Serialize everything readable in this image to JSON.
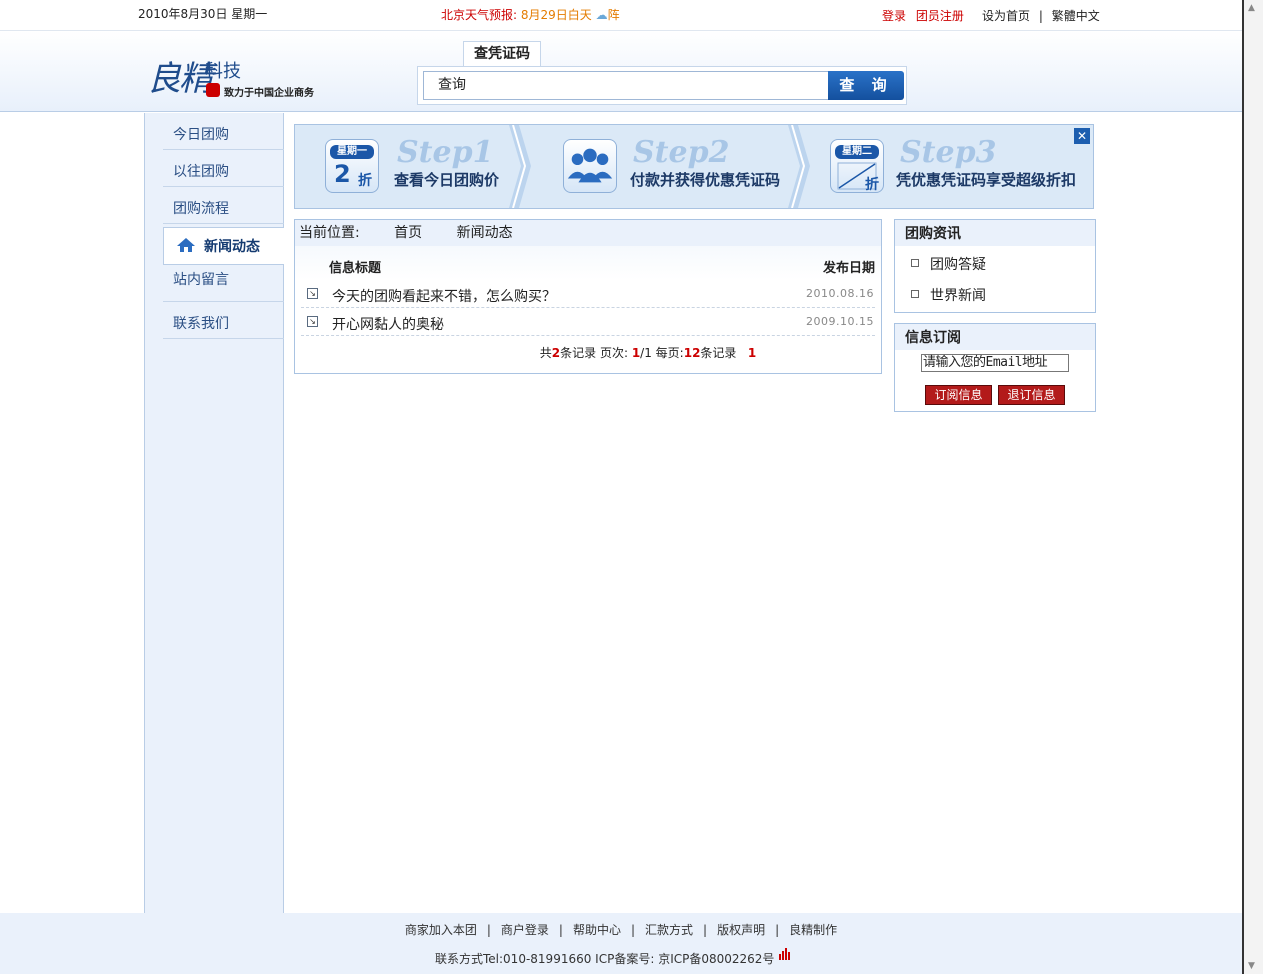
{
  "topbar": {
    "date": "2010年8月30日  星期一",
    "weather_label": "北京天气预报:",
    "weather_value": "8月29日白天",
    "weather_icon": "rain-cloud-icon",
    "weather_text": "阵",
    "login": "登录",
    "register": "团员注册",
    "homepage": "设为首页",
    "sep": "|",
    "traditional": "繁體中文"
  },
  "logo": {
    "main": "良精",
    "sub1": "科技",
    "sub2": "致力于中国企业商务"
  },
  "search": {
    "tab": "查凭证码",
    "value": "查询",
    "button": "查 询"
  },
  "sidebar": {
    "items": [
      {
        "label": "今日团购"
      },
      {
        "label": "以往团购"
      },
      {
        "label": "团购流程"
      },
      {
        "label": "新闻动态"
      },
      {
        "label": "站内留言"
      },
      {
        "label": "联系我们"
      }
    ]
  },
  "steps": [
    {
      "day": "星期一",
      "big": "2",
      "small": "折",
      "title": "Step1",
      "desc": "查看今日团购价"
    },
    {
      "title": "Step2",
      "desc": "付款并获得优惠凭证码"
    },
    {
      "day": "星期二",
      "small": "折",
      "title": "Step3",
      "desc": "凭优惠凭证码享受超级折扣"
    }
  ],
  "news": {
    "crumb_label": "当前位置:",
    "crumb_home": "首页",
    "crumb_current": "新闻动态",
    "col_title": "信息标题",
    "col_date": "发布日期",
    "rows": [
      {
        "title": "今天的团购看起来不错，怎么购买？",
        "date": "2010.08.16"
      },
      {
        "title": "开心网黏人的奥秘",
        "date": "2009.10.15"
      }
    ],
    "pager": {
      "p1": "共",
      "total": "2",
      "p2": "条记录 页次:",
      "cur": "1",
      "p3": "/1 每页:",
      "per": "12",
      "p4": "条记录",
      "page": "1"
    }
  },
  "info_box": {
    "title": "团购资讯",
    "items": [
      "团购答疑",
      "世界新闻"
    ]
  },
  "subscribe_box": {
    "title": "信息订阅",
    "email_value": "请输入您的Email地址",
    "subscribe": "订阅信息",
    "unsubscribe": "退订信息"
  },
  "footer": {
    "links": [
      "商家加入本团",
      "商户登录",
      "帮助中心",
      "汇款方式",
      "版权声明",
      "良精制作"
    ],
    "sep": "|",
    "contact": "联系方式Tel:010-81991660 ICP备案号: 京ICP备08002262号"
  },
  "colors": {
    "accent": "#1b57a8",
    "red": "#c00000",
    "panel": "#eaf1fb"
  }
}
